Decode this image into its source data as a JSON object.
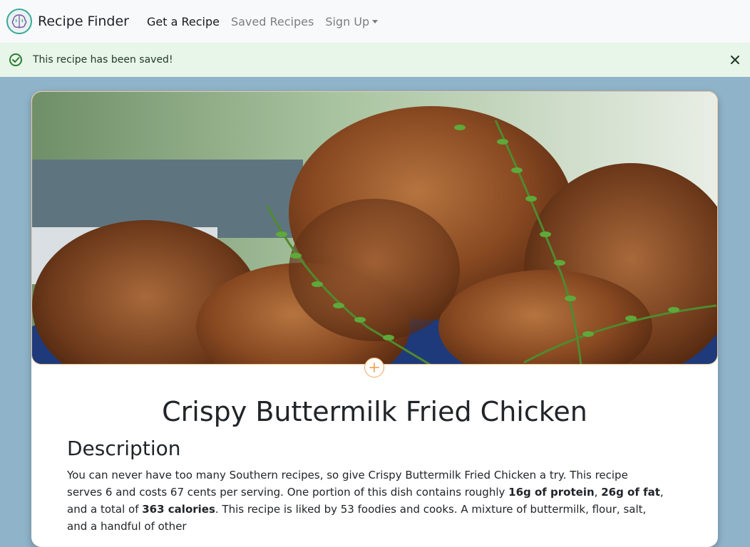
{
  "navbar": {
    "brand": "Recipe Finder",
    "items": [
      {
        "label": "Get a Recipe"
      },
      {
        "label": "Saved Recipes"
      },
      {
        "label": "Sign Up"
      }
    ]
  },
  "alert": {
    "message": "This recipe has been saved!",
    "icon": "check-circle-icon",
    "close_icon": "close-icon"
  },
  "recipe": {
    "title": "Crispy Buttermilk Fried Chicken",
    "description_heading": "Description",
    "description": {
      "p1": "You can never have too many Southern recipes, so give Crispy Buttermilk Fried Chicken a try. This recipe serves 6 and costs 67 cents per serving. One portion of this dish contains roughly ",
      "protein": "16g of protein",
      "sep1": ", ",
      "fat": "26g of fat",
      "p2": ", and a total of ",
      "calories": "363 calories",
      "p3": ". This recipe is liked by 53 foodies and cooks. A mixture of buttermilk, flour, salt, and a handful of other"
    }
  },
  "colors": {
    "page_bg": "#8fb3c9",
    "navbar_bg": "#f8f9fa",
    "alert_bg": "#e8f5e9",
    "accent": "#f2a65a"
  }
}
